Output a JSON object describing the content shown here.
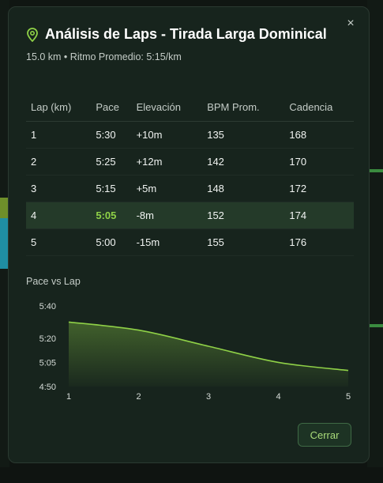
{
  "modal": {
    "title": "Análisis de Laps - Tirada Larga Dominical",
    "subtitle": "15.0 km • Ritmo Promedio: 5:15/km",
    "close_symbol": "×",
    "close_button_label": "Cerrar"
  },
  "table": {
    "headers": [
      "Lap (km)",
      "Pace",
      "Elevación",
      "BPM Prom.",
      "Cadencia"
    ],
    "rows": [
      {
        "lap": "1",
        "pace": "5:30",
        "elevation": "+10m",
        "bpm": "135",
        "cadence": "168"
      },
      {
        "lap": "2",
        "pace": "5:25",
        "elevation": "+12m",
        "bpm": "142",
        "cadence": "170"
      },
      {
        "lap": "3",
        "pace": "5:15",
        "elevation": "+5m",
        "bpm": "148",
        "cadence": "172"
      },
      {
        "lap": "4",
        "pace": "5:05",
        "elevation": "-8m",
        "bpm": "152",
        "cadence": "174"
      },
      {
        "lap": "5",
        "pace": "5:00",
        "elevation": "-15m",
        "bpm": "155",
        "cadence": "176"
      }
    ],
    "highlighted_row_index": 3
  },
  "chart_data": {
    "type": "area",
    "title": "Pace vs Lap",
    "x": [
      1,
      2,
      3,
      4,
      5
    ],
    "x_tick_labels": [
      "1",
      "2",
      "3",
      "4",
      "5"
    ],
    "y_tick_labels": [
      "5:40",
      "5:20",
      "5:05",
      "4:50"
    ],
    "series": [
      {
        "values": [
          "5:30",
          "5:25",
          "5:15",
          "5:05",
          "5:00"
        ]
      }
    ],
    "color": "#8fd147"
  },
  "colors": {
    "accent": "#8fd147",
    "modal_bg": "#17241d",
    "highlight_row": "#243a29"
  },
  "icons": {
    "title_icon": "map-pin-icon",
    "close_icon": "close-icon"
  }
}
